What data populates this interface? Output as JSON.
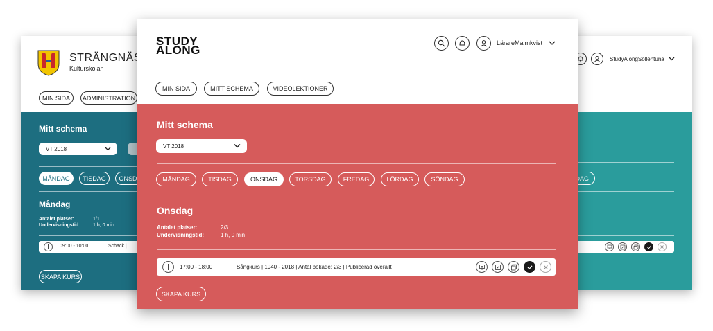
{
  "left": {
    "org_name": "STRÄNGNÄS K",
    "org_sub": "Kulturskolan",
    "nav": [
      "MIN SIDA",
      "ADMINISTRATION"
    ],
    "section_title": "Mitt schema",
    "term": "VT 2018",
    "days": [
      "MÅNDAG",
      "TISDAG",
      "ONSDAG"
    ],
    "day_title": "Måndag",
    "info_labels": [
      "Antalet platser:",
      "Undervisningstid:"
    ],
    "info_values": [
      "1/1",
      "1 h, 0 min"
    ],
    "course_time": "09:00 - 10:00",
    "course_name": "Schack |",
    "create_label": "SKAPA KURS",
    "colors": {
      "panel": "#1d6e80"
    }
  },
  "right": {
    "user": "StudyAlongSollentuna",
    "day_pill": "DAG",
    "colors": {
      "panel": "#2a9c9c"
    }
  },
  "main": {
    "logo_line1": "STUDY",
    "logo_line2": "ALONG",
    "user": "LärareMalmkvist",
    "nav": [
      "MIN SIDA",
      "MITT SCHEMA",
      "VIDEOLEKTIONER"
    ],
    "section_title": "Mitt schema",
    "term": "VT 2018",
    "days": [
      "MÅNDAG",
      "TISDAG",
      "ONSDAG",
      "TORSDAG",
      "FREDAG",
      "LÖRDAG",
      "SÖNDAG"
    ],
    "active_day": "ONSDAG",
    "day_title": "Onsdag",
    "info_labels": [
      "Antalet platser:",
      "Undervisningstid:"
    ],
    "info_values": [
      "2/3",
      "1 h, 0 min"
    ],
    "course_time": "17:00 - 18:00",
    "course_desc": "Sångkurs | 1940 - 2018 | Antal bokade: 2/3 | Publicerad överallt",
    "create_label": "SKAPA KURS",
    "colors": {
      "panel": "#d65b5b"
    }
  }
}
